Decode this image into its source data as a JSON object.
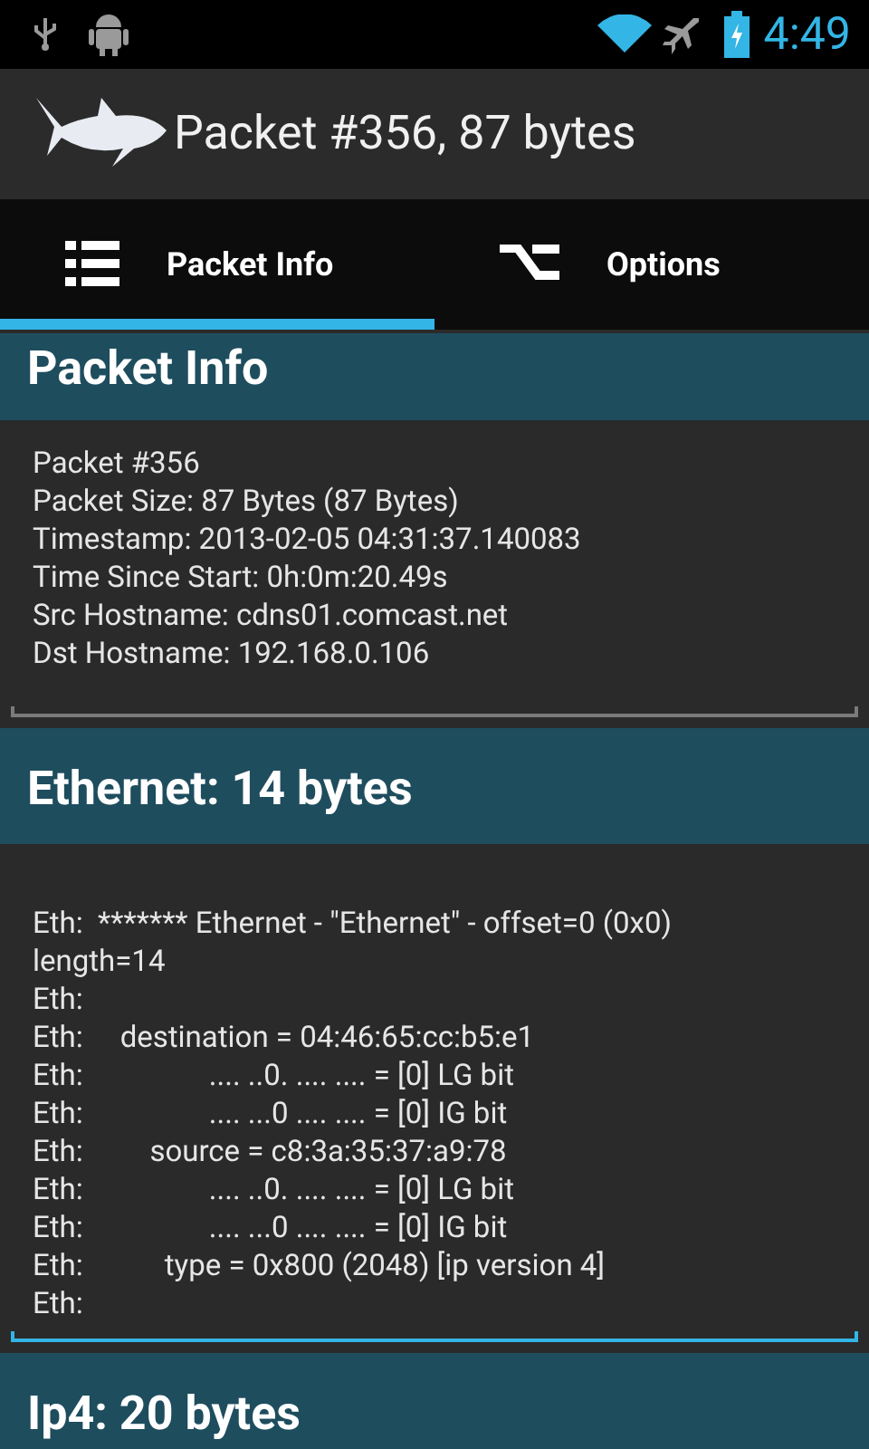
{
  "status_bar": {
    "time": "4:49"
  },
  "action_bar": {
    "title": "Packet #356, 87 bytes"
  },
  "tabs": [
    {
      "label": "Packet Info",
      "kind": "list",
      "selected": true
    },
    {
      "label": "Options",
      "kind": "option",
      "selected": false
    }
  ],
  "sections": [
    {
      "title": "Packet Info",
      "selected": false,
      "lines": [
        "Packet #356",
        "Packet Size: 87 Bytes (87 Bytes)",
        "Timestamp: 2013-02-05 04:31:37.140083",
        "Time Since Start: 0h:0m:20.49s",
        "Src Hostname: cdns01.comcast.net",
        "Dst Hostname: 192.168.0.106"
      ]
    },
    {
      "title": "Ethernet: 14 bytes",
      "selected": true,
      "lines": [
        "Eth:  ******* Ethernet - \"Ethernet\" - offset=0 (0x0)",
        "length=14",
        "Eth:",
        "Eth:     destination = 04:46:65:cc:b5:e1",
        "Eth:                 .... ..0. .... .... = [0] LG bit",
        "Eth:                 .... ...0 .... .... = [0] IG bit",
        "Eth:         source = c8:3a:35:37:a9:78",
        "Eth:                 .... ..0. .... .... = [0] LG bit",
        "Eth:                 .... ...0 .... .... = [0] IG bit",
        "Eth:           type = 0x800 (2048) [ip version 4]",
        "Eth:"
      ]
    },
    {
      "title": "Ip4: 20 bytes"
    }
  ]
}
